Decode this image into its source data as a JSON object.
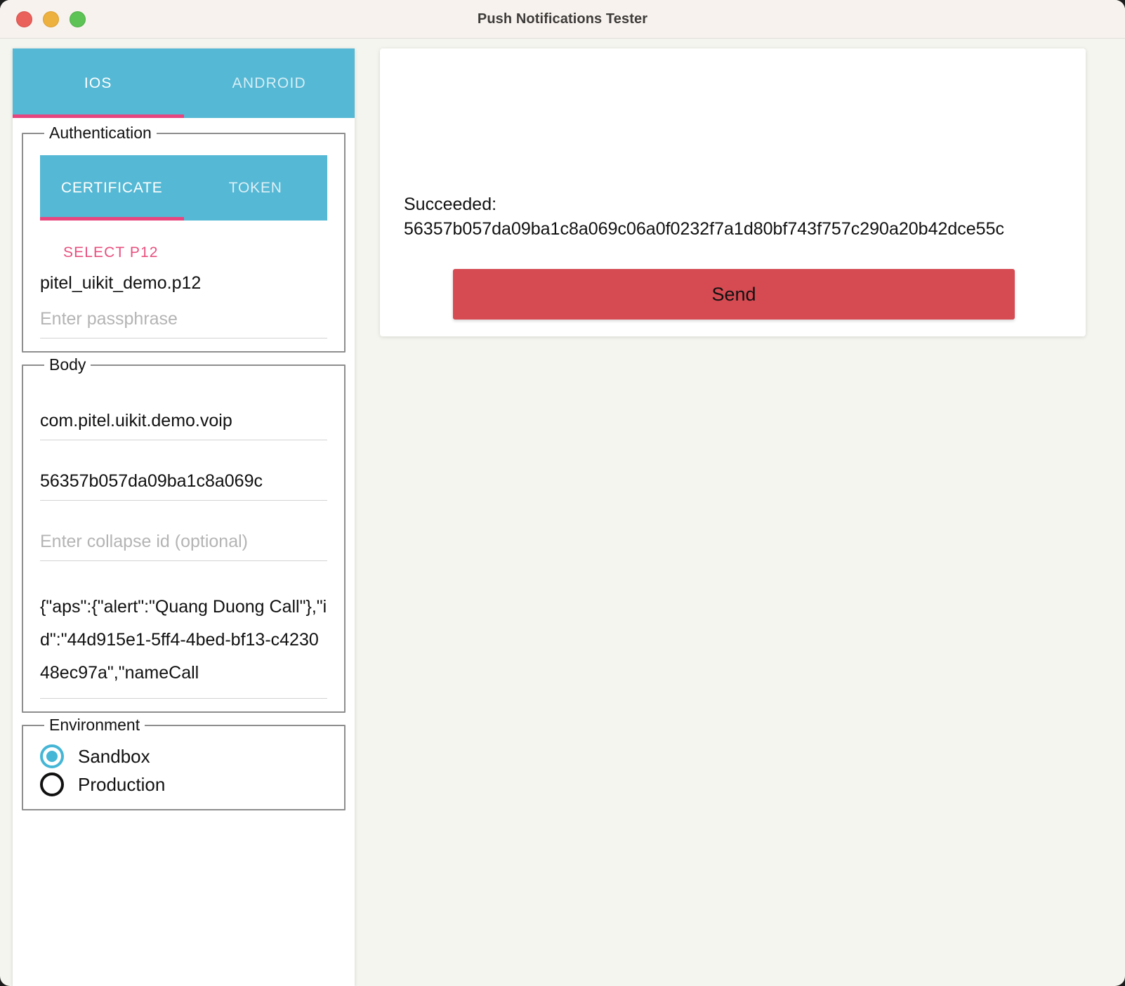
{
  "window": {
    "title": "Push Notifications Tester",
    "traffic_lights": [
      "close",
      "minimize",
      "maximize"
    ]
  },
  "platform_tabs": {
    "items": [
      {
        "label": "IOS",
        "active": true
      },
      {
        "label": "ANDROID",
        "active": false
      }
    ]
  },
  "authentication": {
    "legend": "Authentication",
    "tabs": [
      {
        "label": "CERTIFICATE",
        "active": true
      },
      {
        "label": "TOKEN",
        "active": false
      }
    ],
    "select_p12_label": "SELECT P12",
    "selected_file": "pitel_uikit_demo.p12",
    "passphrase_placeholder": "Enter passphrase",
    "passphrase_value": ""
  },
  "body": {
    "legend": "Body",
    "bundle_id": "com.pitel.uikit.demo.voip",
    "device_token": "56357b057da09ba1c8a069c",
    "collapse_id_placeholder": "Enter collapse id (optional)",
    "collapse_id_value": "",
    "payload": "{\"aps\":{\"alert\":\"Quang Duong Call\"},\"id\":\"44d915e1-5ff4-4bed-bf13-c423048ec97a\",\"nameCall"
  },
  "environment": {
    "legend": "Environment",
    "options": [
      {
        "label": "Sandbox",
        "selected": true
      },
      {
        "label": "Production",
        "selected": false
      }
    ]
  },
  "output": {
    "status_line": "Succeeded:",
    "token_line": "56357b057da09ba1c8a069c06a0f0232f7a1d80bf743f757c290a20b42dce55c",
    "send_label": "Send"
  },
  "colors": {
    "teal": "#55b8d4",
    "pink": "#e8457f",
    "red": "#d64a52",
    "background": "#f5f5ef",
    "titlebar": "#f7f2ee"
  }
}
